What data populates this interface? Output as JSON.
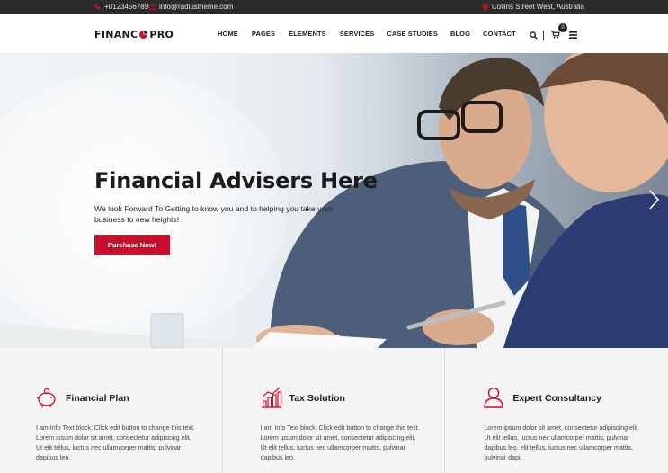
{
  "topbar": {
    "phone": "+0123456789",
    "email": "info@radiustheme.com",
    "address": "Collins Street West, Australia"
  },
  "header": {
    "logo_left": "FINANC",
    "logo_right": "PRO",
    "nav": [
      "HOME",
      "PAGES",
      "ELEMENTS",
      "SERVICES",
      "CASE STUDIES",
      "BLOG",
      "CONTACT"
    ],
    "cart_count": "0"
  },
  "hero": {
    "title": "Financial Advisers Here",
    "text": "We look Forward To Getting to know you and to helping you take your business to new heights!",
    "button": "Purchase Now!",
    "slides": 2,
    "active_slide": 2
  },
  "services": [
    {
      "icon": "piggy-bank-icon",
      "title": "Financial Plan",
      "text": "I am Info Text block. Click edit button to change this text. Lorem ipsum dolor sit amet, consectetur adipiscing elit. Ut elit tellus, luctus nec ullamcorper mattis, pulvinar dapibus leo."
    },
    {
      "icon": "bar-chart-icon",
      "title": "Tax Solution",
      "text": "I am Info Text block. Click edit button to change this text. Lorem ipsum dolor sit amet, consectetur adipiscing elit. Ut elit tellus, luctus nec ullamcorper mattis, pulvinar dapibus leo."
    },
    {
      "icon": "user-icon",
      "title": "Expert Consultancy",
      "text": "Lorem ipsum dolor sit amet, consectetur adipiscing elit. Ut elit tellus, luctus nec ullamcorper mattis, pulvinar dapibus leo. elit tellus, luctus nec ullamcorper mattis, pulvinar dapi."
    }
  ],
  "colors": {
    "accent": "#c8102e",
    "topbar_bg": "#2b2b2b",
    "services_bg": "#f4f4f4"
  }
}
